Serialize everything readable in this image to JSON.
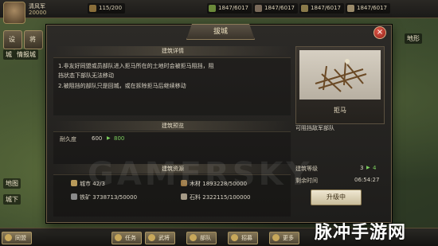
{
  "game": {
    "player_name": "清风军",
    "player_value": "20000",
    "resources": [
      {
        "id": "r1",
        "text": "115/200",
        "color": "#8a6e3a"
      },
      {
        "id": "r2",
        "text": "1847/6017",
        "color": "#6b8a3a"
      },
      {
        "id": "r3",
        "text": "1847/6017",
        "color": "#7a6a5a"
      },
      {
        "id": "r4",
        "text": "1847/6017",
        "color": "#8a7a4a"
      },
      {
        "id": "r5",
        "text": "1847/6017",
        "color": "#9a8a6a"
      }
    ],
    "left_sidebar": {
      "buttons": [
        "设",
        "将"
      ],
      "labels": [
        "城",
        "情报城",
        "地图",
        "城下"
      ]
    },
    "right_sidebar": {
      "label": "地形"
    },
    "bottom_bar": [
      "任务",
      "武将",
      "部队",
      "招募",
      "更多",
      "同盟"
    ],
    "watermark": "脉冲手游网",
    "overlay_watermark": "GAMERSKY"
  },
  "dialog": {
    "title": "拔城",
    "close_symbol": "×",
    "details": {
      "header": "建筑详情",
      "lines": [
        "1.非友好同盟或员部队进入拒马所在的土地时会被拒马阻挡，阻",
        "  挡状态下部队无法移动",
        "2.被阻挡的部队只是回城，或在拆除拒马后继续移动"
      ]
    },
    "preview": {
      "header": "建筑预览",
      "durability_label": "耐久度",
      "durability_current": "600",
      "arrow": "▶",
      "durability_next": "800"
    },
    "cost": {
      "header": "建筑资源",
      "items": [
        {
          "name": "城市",
          "value": "42/3",
          "color": "#b89a5a"
        },
        {
          "name": "木材",
          "value": "1893228/50000",
          "color": "#9c7a46"
        },
        {
          "name": "铁矿",
          "value": "3738713/50000",
          "color": "#8a8a8a"
        },
        {
          "name": "石料",
          "value": "2322115/100000",
          "color": "#a59a86"
        }
      ]
    },
    "card": {
      "name": "拒马",
      "description": "可阻挡敌军部队"
    },
    "level": {
      "label": "建筑等级",
      "current": "3",
      "arrow": "▶",
      "next": "4"
    },
    "timer": {
      "label": "剩余时间",
      "value": "06:54:27"
    },
    "upgrade_button": "升级中"
  }
}
